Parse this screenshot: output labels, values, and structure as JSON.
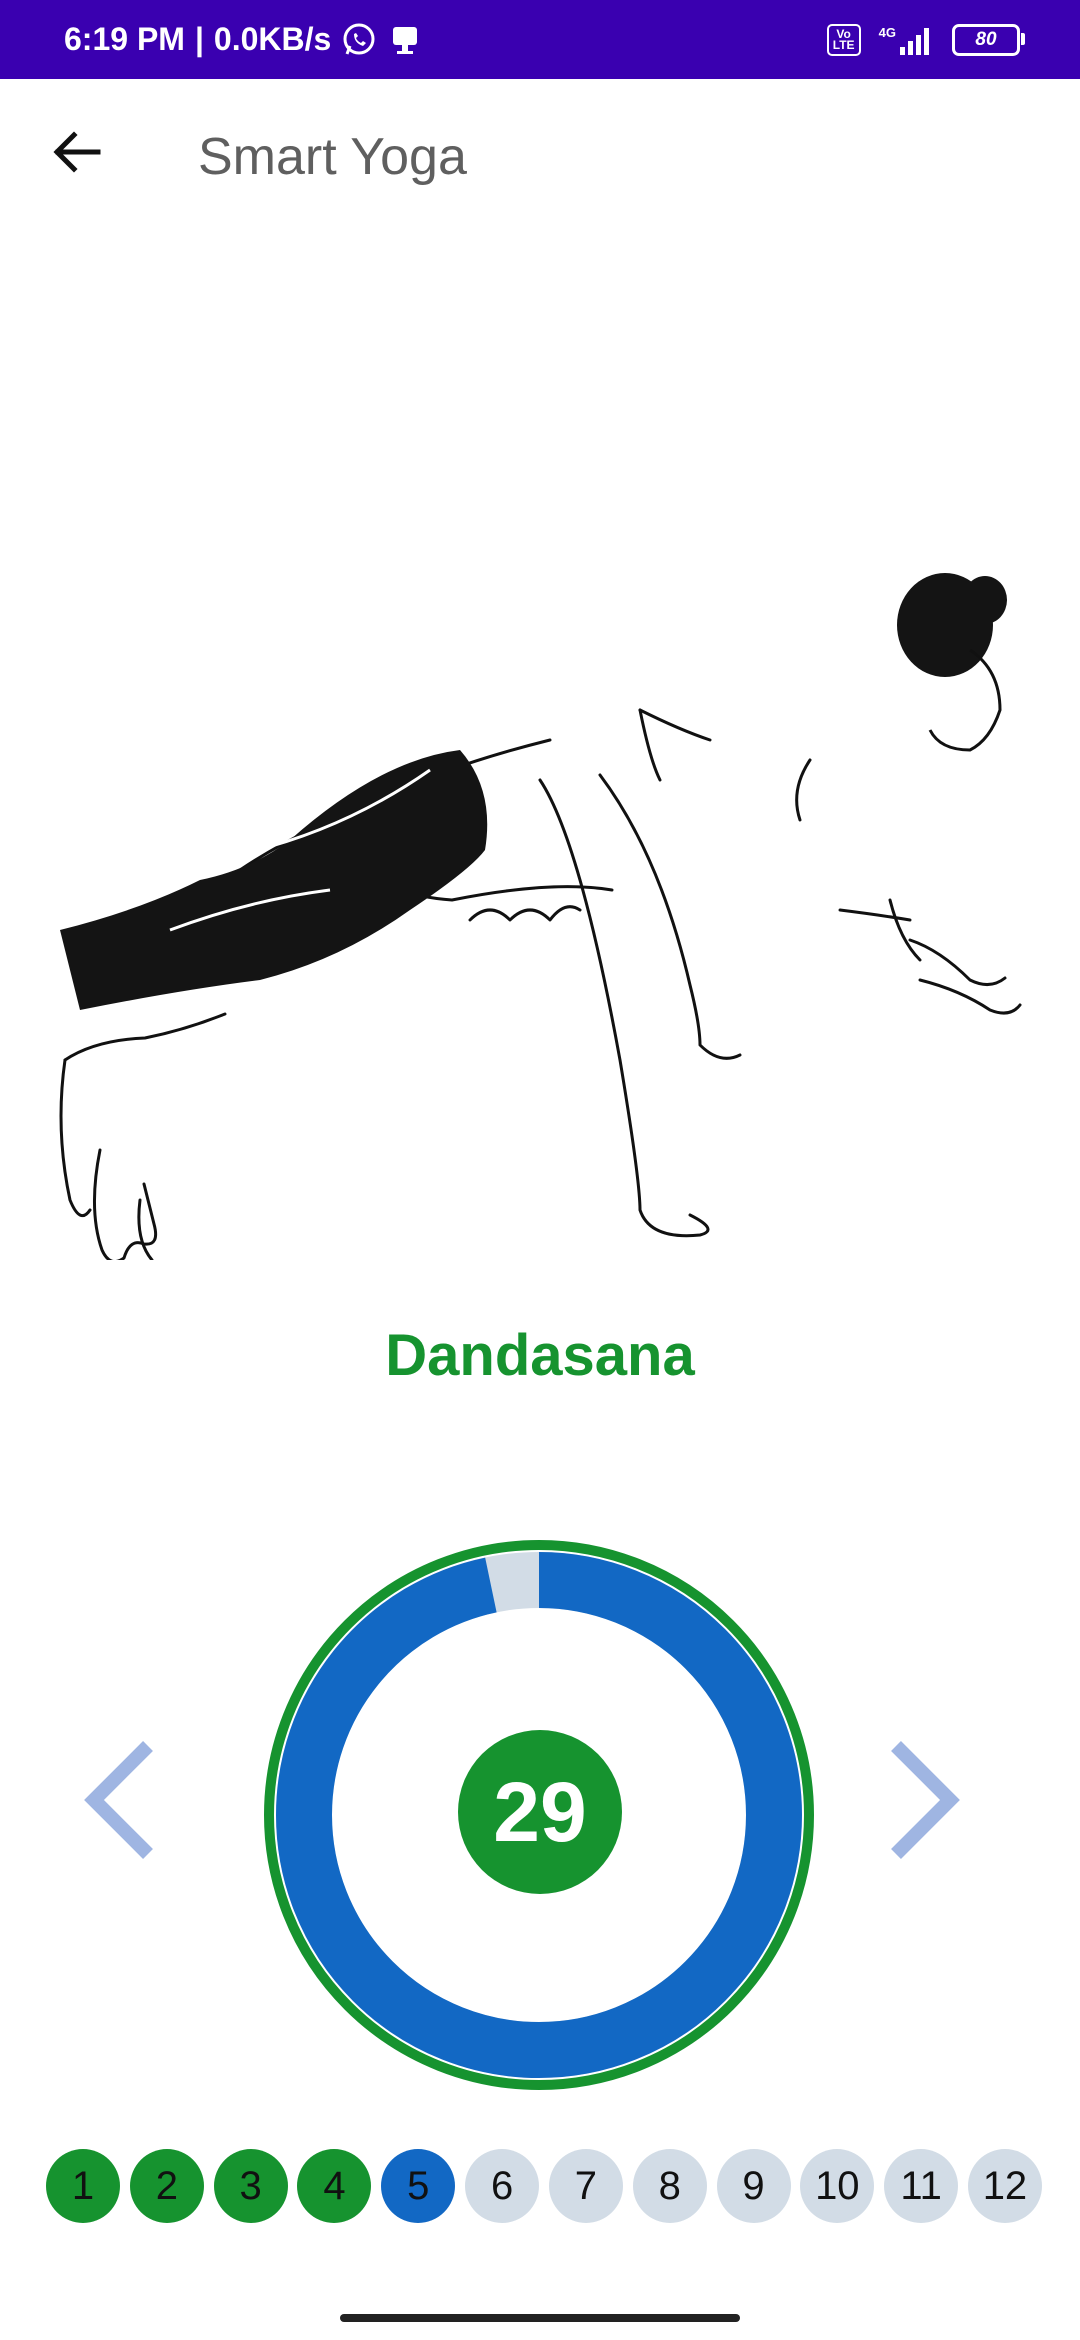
{
  "status_bar": {
    "time": "6:19 PM",
    "network_speed": "0.0KB/s",
    "volte": "Vo LTE",
    "network_type": "4G",
    "battery": "80"
  },
  "app_bar": {
    "title": "Smart Yoga"
  },
  "pose": {
    "name": "Dandasana",
    "timer_value": "29",
    "progress_fraction": 0.967
  },
  "steps": [
    {
      "label": "1",
      "state": "completed"
    },
    {
      "label": "2",
      "state": "completed"
    },
    {
      "label": "3",
      "state": "completed"
    },
    {
      "label": "4",
      "state": "completed"
    },
    {
      "label": "5",
      "state": "current"
    },
    {
      "label": "6",
      "state": "pending"
    },
    {
      "label": "7",
      "state": "pending"
    },
    {
      "label": "8",
      "state": "pending"
    },
    {
      "label": "9",
      "state": "pending"
    },
    {
      "label": "10",
      "state": "pending"
    },
    {
      "label": "11",
      "state": "pending"
    },
    {
      "label": "12",
      "state": "pending"
    }
  ],
  "colors": {
    "status_bar": "#3a00b0",
    "pose_title": "#16932f",
    "completed": "#16932f",
    "current": "#1268c4",
    "pending": "#d2dce6",
    "arrows": "#9fb5e2",
    "progress": "#1268c4",
    "progress_remaining": "#d2dce6",
    "ring_outer": "#16932f",
    "timer_badge": "#16932f"
  }
}
